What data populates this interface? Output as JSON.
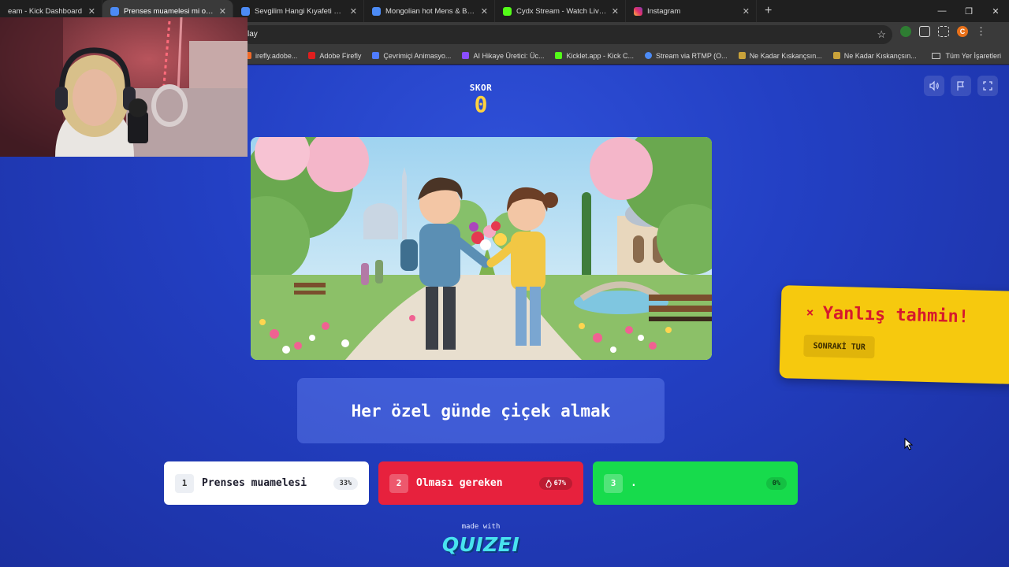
{
  "browser": {
    "tabs": [
      {
        "title": "eam - Kick Dashboard",
        "favicon_color": "#53fc18"
      },
      {
        "title": "Prenses muamelesi mi olması g",
        "favicon_color": "#4c8bf5",
        "active": true
      },
      {
        "title": "Sevgilim Hangi Kıyafeti Dışarda",
        "favicon_color": "#4c8bf5"
      },
      {
        "title": "Mongolian hot Mens & Boys -",
        "favicon_color": "#4c8bf5"
      },
      {
        "title": "Cydx Stream - Watch Live on K",
        "favicon_color": "#53fc18"
      },
      {
        "title": "Instagram",
        "favicon_color": "#e1306c"
      }
    ],
    "new_tab_symbol": "+",
    "address": "lay",
    "bookmarks": [
      {
        "label": "irefly.adobe...",
        "color": "#f06a29"
      },
      {
        "label": "Adobe Firefly",
        "color": "#e01e1e"
      },
      {
        "label": "Çevrimiçi Animasyo...",
        "color": "#4f7cff"
      },
      {
        "label": "AI Hikaye Üretici: Üc...",
        "color": "#8a4dff"
      },
      {
        "label": "Kicklet.app - Kick C...",
        "color": "#53fc18"
      },
      {
        "label": "Stream via RTMP (O...",
        "color": "#4c8bf5"
      },
      {
        "label": "Ne Kadar Kıskançsın...",
        "color": "#c9a23a"
      },
      {
        "label": "Ne Kadar Kıskançsın...",
        "color": "#c9a23a"
      }
    ],
    "all_bookmarks": "Tüm Yer İşaretleri",
    "profile_initial": "C"
  },
  "game": {
    "score_label": "SKOR",
    "score_value": "0",
    "prompt": "Her özel günde çiçek almak",
    "options": [
      {
        "num": "1",
        "label": "Prenses muamelesi",
        "pct": "33%"
      },
      {
        "num": "2",
        "label": "Olması gereken",
        "pct": "67%"
      },
      {
        "num": "3",
        "label": ".",
        "pct": "0%"
      }
    ],
    "made_with": "made with",
    "brand": "QUIZEI"
  },
  "toast": {
    "x": "×",
    "title": "Yanlış tahmin!",
    "button": "SONRAKİ TUR"
  },
  "colors": {
    "background": "#2340c4",
    "score": "#ffd23f",
    "option_white": "#ffffff",
    "option_red": "#e7213d",
    "option_green": "#17db4c",
    "toast_bg": "#f6c90e",
    "toast_text": "#d6192d"
  },
  "icons": [
    "speaker-icon",
    "flag-icon",
    "fullscreen-icon",
    "fire-icon",
    "star-icon",
    "extensions-icon",
    "folder-icon"
  ]
}
